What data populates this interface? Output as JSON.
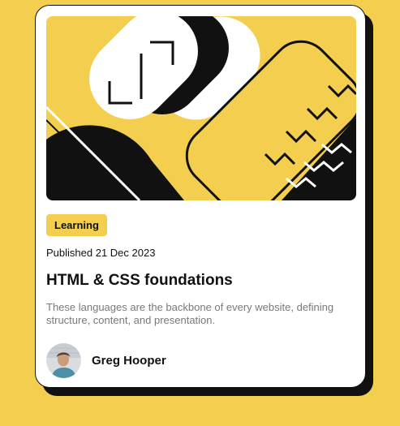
{
  "card": {
    "tag": "Learning",
    "published": "Published 21 Dec 2023",
    "title": "HTML & CSS foundations",
    "description": "These languages are the backbone of every website, defining structure, content, and presentation.",
    "author_name": "Greg Hooper"
  },
  "colors": {
    "background": "#F4CE4E",
    "card": "#FFFFFF",
    "ink": "#111111",
    "muted_text": "#7A7A7A"
  },
  "icons": {
    "hero": "abstract-illustration",
    "avatar": "author-avatar"
  }
}
